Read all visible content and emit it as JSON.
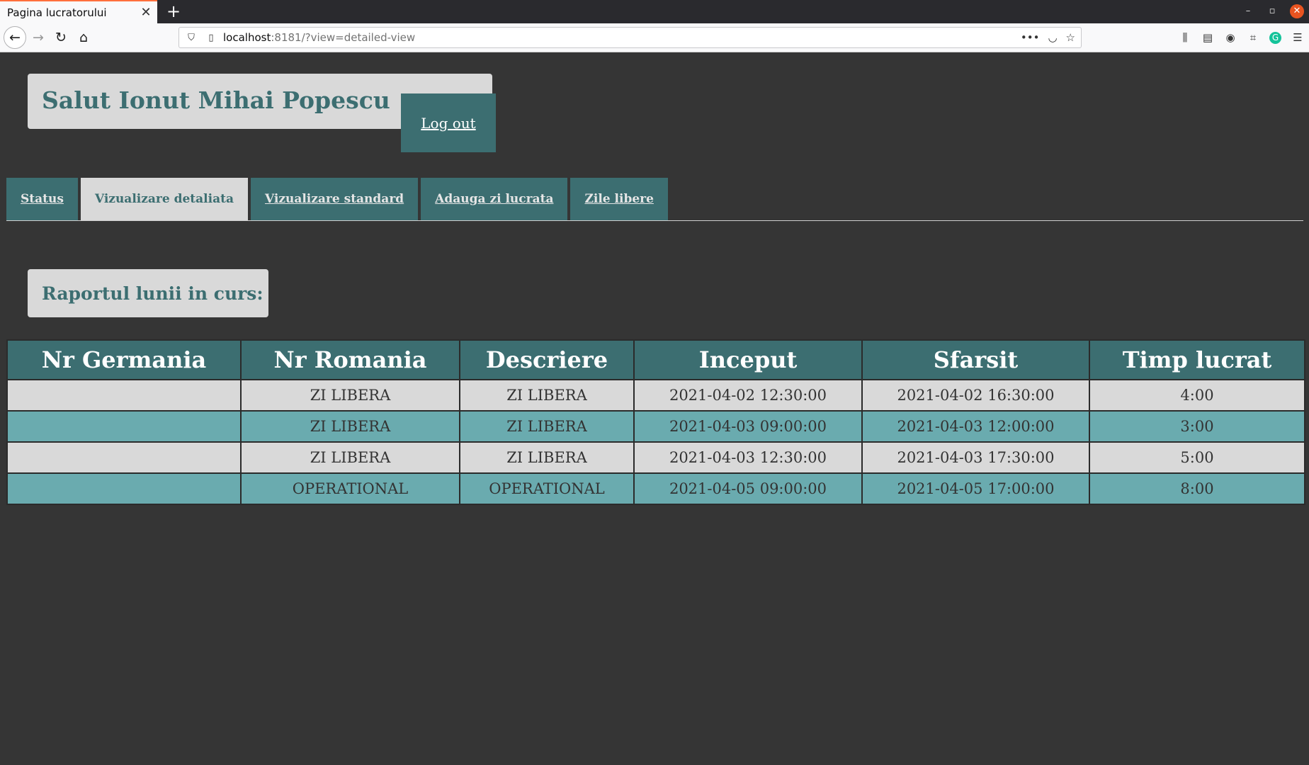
{
  "browser": {
    "tab_title": "Pagina lucratorului",
    "tab_close": "✕",
    "new_tab": "+",
    "url_host": "localhost",
    "url_rest": ":8181/?view=detailed-view",
    "window_controls": [
      "–",
      "▫",
      "✕"
    ],
    "icons": [
      "back-icon",
      "forward-icon",
      "reload-icon",
      "home-icon",
      "shield-icon",
      "page-icon",
      "more-icon",
      "pocket-icon",
      "bookmark-star-icon",
      "library-icon",
      "sidebar-icon",
      "account-icon",
      "extension-icon",
      "grammarly-icon",
      "menu-icon"
    ]
  },
  "header": {
    "greeting": "Salut Ionut Mihai Popescu",
    "logout_label": "Log out"
  },
  "tabs": [
    {
      "label": "Status",
      "active": false
    },
    {
      "label": "Vizualizare detaliata",
      "active": true
    },
    {
      "label": "Vizualizare standard",
      "active": false
    },
    {
      "label": "Adauga zi lucrata",
      "active": false
    },
    {
      "label": "Zile libere",
      "active": false
    }
  ],
  "report": {
    "title": "Raportul lunii in curs:",
    "columns": [
      "Nr Germania",
      "Nr Romania",
      "Descriere",
      "Inceput",
      "Sfarsit",
      "Timp lucrat"
    ],
    "rows": [
      [
        "",
        "ZI LIBERA",
        "ZI LIBERA",
        "2021-04-02 12:30:00",
        "2021-04-02 16:30:00",
        "4:00"
      ],
      [
        "",
        "ZI LIBERA",
        "ZI LIBERA",
        "2021-04-03 09:00:00",
        "2021-04-03 12:00:00",
        "3:00"
      ],
      [
        "",
        "ZI LIBERA",
        "ZI LIBERA",
        "2021-04-03 12:30:00",
        "2021-04-03 17:30:00",
        "5:00"
      ],
      [
        "",
        "OPERATIONAL",
        "OPERATIONAL",
        "2021-04-05 09:00:00",
        "2021-04-05 17:00:00",
        "8:00"
      ]
    ]
  },
  "colors": {
    "background": "#353535",
    "accent": "#3c6e71",
    "panel": "#d9d9d9",
    "row_alt": "#6aabaf"
  }
}
